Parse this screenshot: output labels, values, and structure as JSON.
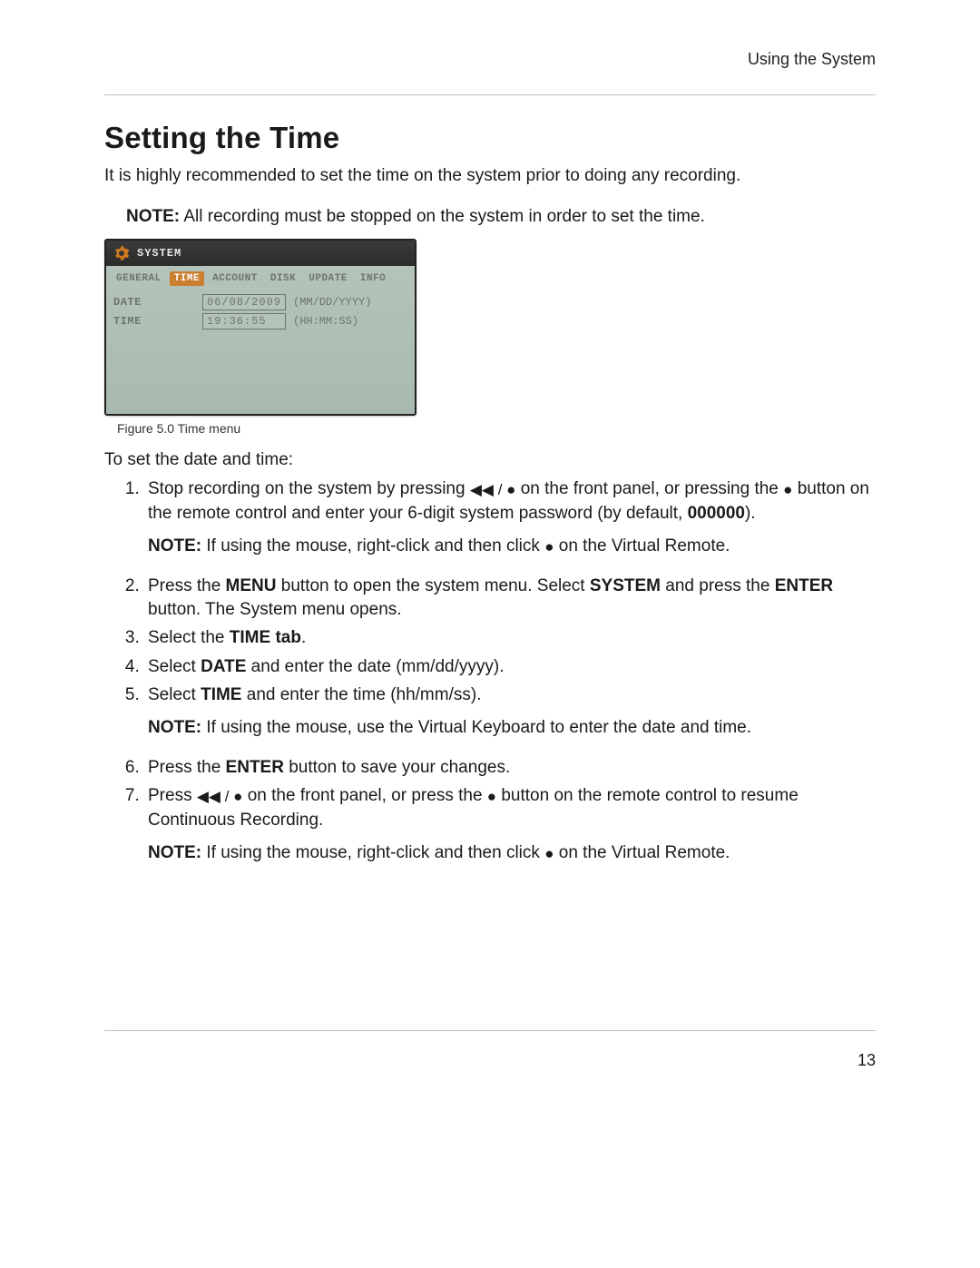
{
  "header": {
    "breadcrumb": "Using the System"
  },
  "title": "Setting the Time",
  "intro": "It is highly recommended to set the time on the system prior to doing any recording.",
  "top_note": {
    "label": "NOTE:",
    "text": "All recording must be stopped on the system in order to set the time."
  },
  "screenshot": {
    "window_title": "SYSTEM",
    "tabs": [
      "GENERAL",
      "TIME",
      "ACCOUNT",
      "DISK",
      "UPDATE",
      "INFO"
    ],
    "active_tab_index": 1,
    "rows": [
      {
        "label": "DATE",
        "value": "06/08/2009",
        "hint": "(MM/DD/YYYY)"
      },
      {
        "label": "TIME",
        "value": "19:36:55",
        "hint": "(HH:MM:SS)"
      }
    ],
    "caption": "Figure 5.0 Time menu"
  },
  "lead": "To set the date and time:",
  "steps": {
    "s1_a": "Stop recording on the system by pressing ",
    "s1_b": " on the front panel, or pressing the ",
    "s1_c": " button on the remote control and enter your 6-digit system password (by default, ",
    "s1_pwd": "000000",
    "s1_d": ").",
    "s1_note_label": "NOTE:",
    "s1_note": "If using the mouse, right-click and then click ",
    "s1_note_tail": " on the Virtual Remote.",
    "s2_a": "Press the ",
    "s2_menu": "MENU",
    "s2_b": " button to open the system menu. Select ",
    "s2_system": "SYSTEM",
    "s2_c": " and press the ",
    "s2_enter": "ENTER",
    "s2_d": " button. The System menu opens.",
    "s3_a": "Select the ",
    "s3_time": "TIME tab",
    "s3_b": ".",
    "s4_a": "Select ",
    "s4_date": "DATE",
    "s4_b": " and enter the date (mm/dd/yyyy).",
    "s5_a": "Select ",
    "s5_time": "TIME",
    "s5_b": " and enter the time (hh/mm/ss).",
    "s5_note_label": "NOTE:",
    "s5_note": "If using the mouse, use the Virtual Keyboard to enter the date and time.",
    "s6_a": "Press the ",
    "s6_enter": "ENTER",
    "s6_b": " button to save your changes.",
    "s7_a": "Press ",
    "s7_b": " on the front panel, or press the ",
    "s7_c": " button on the remote control to resume Continuous Recording.",
    "s7_note_label": "NOTE:",
    "s7_note": "If using the mouse, right-click and then click ",
    "s7_note_tail": " on the Virtual Remote."
  },
  "symbols": {
    "rewind_record": "◀◀ / ●",
    "record": "●"
  },
  "page_number": "13"
}
